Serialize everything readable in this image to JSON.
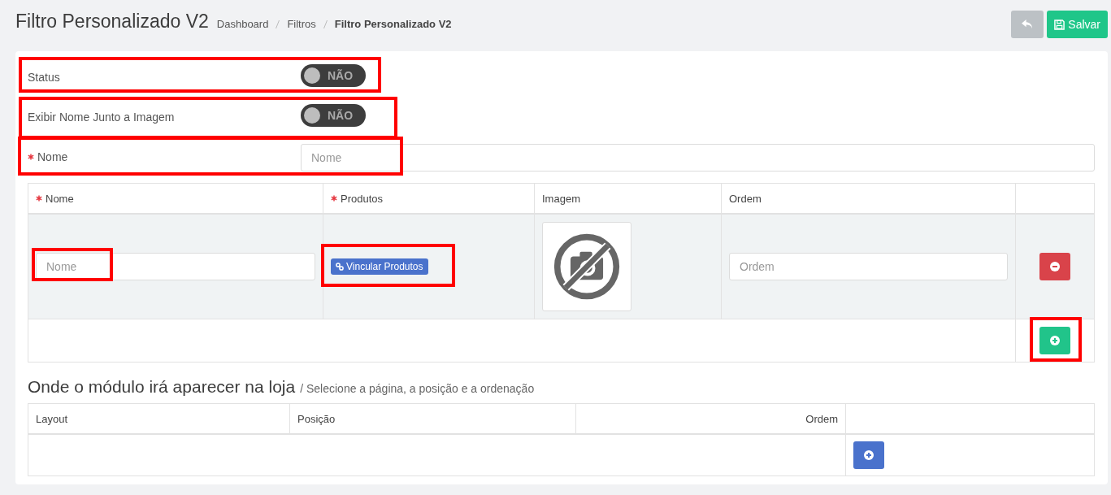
{
  "page": {
    "title": "Filtro Personalizado V2",
    "breadcrumb": [
      {
        "label": "Dashboard",
        "current": false
      },
      {
        "label": "Filtros",
        "current": false
      },
      {
        "label": "Filtro Personalizado V2",
        "current": true
      }
    ]
  },
  "toolbar": {
    "save_button": "Salvar"
  },
  "form": {
    "toggles": [
      {
        "label": "Status",
        "on": false,
        "state_text": "NÃO",
        "highlighted": true
      },
      {
        "label": "Exibir Nome Junto a Imagem",
        "on": false,
        "state_text": "NÃO",
        "highlighted": true
      }
    ],
    "name": {
      "label": "Nome",
      "required": true,
      "placeholder": "Nome",
      "highlighted": true
    }
  },
  "items_table": {
    "columns": [
      {
        "label": "Nome",
        "required": true
      },
      {
        "label": "Produtos",
        "required": true
      },
      {
        "label": "Imagem",
        "required": false
      },
      {
        "label": "Ordem",
        "required": false
      }
    ],
    "rows": [
      {
        "name_placeholder": "Nome",
        "name_highlighted": true,
        "link_button": "Vincular Produtos",
        "link_highlighted": true,
        "order_placeholder": "Ordem"
      }
    ],
    "add_highlighted": true
  },
  "placement": {
    "title": "Onde o módulo irá aparecer na loja",
    "subtitle": "/ Selecione a página, a posição e a ordenação",
    "columns": [
      "Layout",
      "Posição",
      "Ordem"
    ]
  }
}
